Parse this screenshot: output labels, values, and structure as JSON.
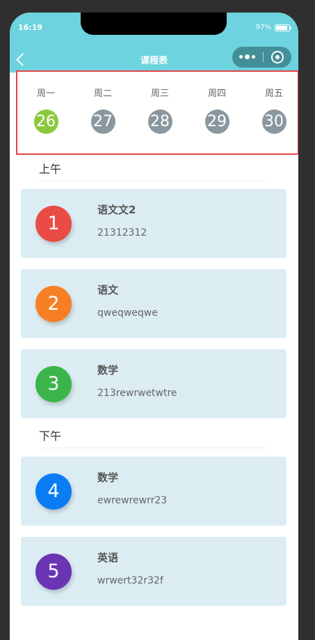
{
  "status": {
    "time": "16:19",
    "battery": "97%"
  },
  "nav": {
    "title": "课程表"
  },
  "week": {
    "days": [
      {
        "label": "周一",
        "date": "26",
        "active": true
      },
      {
        "label": "周二",
        "date": "27",
        "active": false
      },
      {
        "label": "周三",
        "date": "28",
        "active": false
      },
      {
        "label": "周四",
        "date": "29",
        "active": false
      },
      {
        "label": "周五",
        "date": "30",
        "active": false
      }
    ]
  },
  "sections": {
    "morning": "上午",
    "afternoon": "下午"
  },
  "courses": [
    {
      "num": "1",
      "name": "语文文2",
      "info": "21312312",
      "color": "#e84c45"
    },
    {
      "num": "2",
      "name": "语文",
      "info": "qweqweqwe",
      "color": "#f57f22"
    },
    {
      "num": "3",
      "name": "数学",
      "info": "213rewrwetwtre",
      "color": "#3bb54a"
    },
    {
      "num": "4",
      "name": "数学",
      "info": "ewrewrewrr23",
      "color": "#0a7cf4"
    },
    {
      "num": "5",
      "name": "英语",
      "info": "wrwert32r32f",
      "color": "#6a34b4"
    }
  ],
  "colors": {
    "header": "#6dd3de",
    "active_day": "#8bc93c",
    "inactive_day": "#8a979f",
    "card_bg": "#dbedf3"
  }
}
